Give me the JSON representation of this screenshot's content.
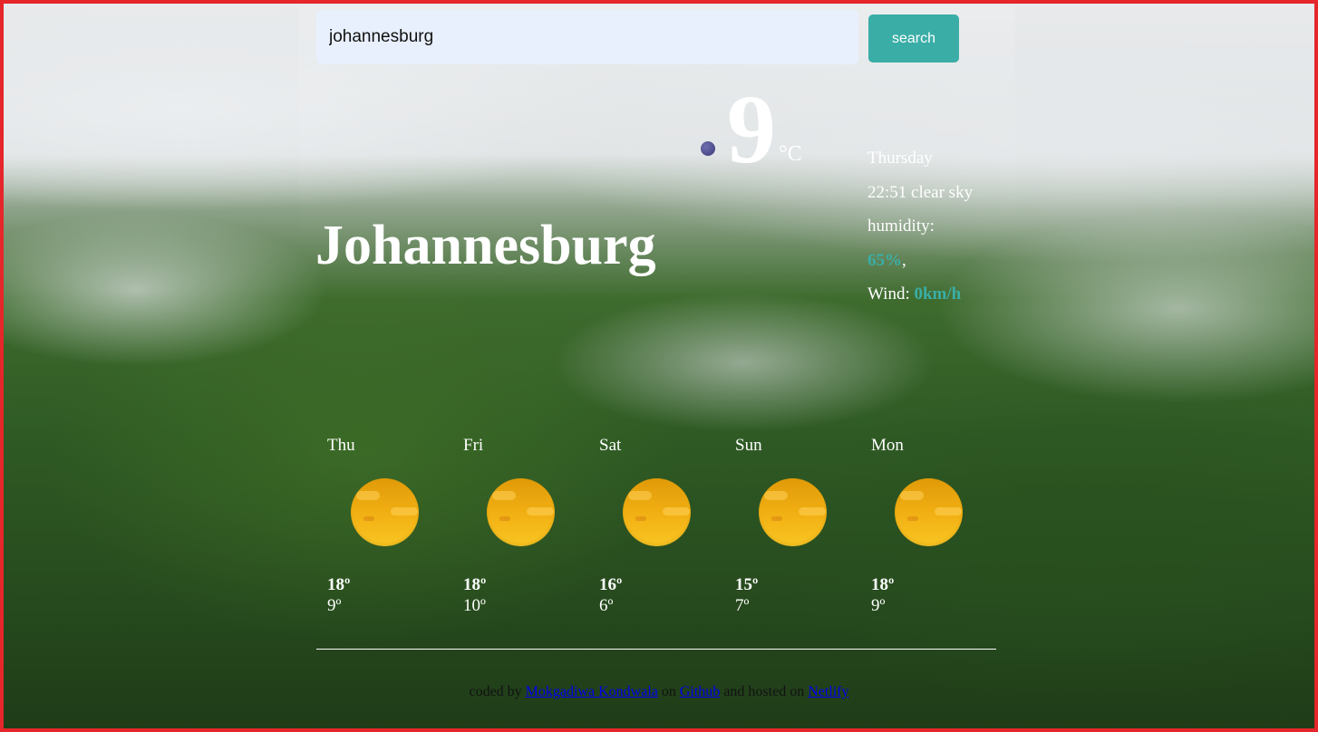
{
  "search": {
    "value": "johannesburg",
    "button_label": "search"
  },
  "current": {
    "city": "Johannesburg",
    "temperature": "9",
    "unit": "°C",
    "icon": "moon-icon",
    "day": "Thursday",
    "time_description": "22:51 clear sky",
    "humidity_label": "humidity:",
    "humidity_value": "65%",
    "wind_label": "Wind:",
    "wind_value": "0km/h"
  },
  "forecast": [
    {
      "day": "Thu",
      "high": "18º",
      "low": "9º",
      "icon": "sun-icon"
    },
    {
      "day": "Fri",
      "high": "18º",
      "low": "10º",
      "icon": "sun-icon"
    },
    {
      "day": "Sat",
      "high": "16º",
      "low": "6º",
      "icon": "sun-icon"
    },
    {
      "day": "Sun",
      "high": "15º",
      "low": "7º",
      "icon": "sun-icon"
    },
    {
      "day": "Mon",
      "high": "18º",
      "low": "9º",
      "icon": "sun-icon"
    }
  ],
  "footer": {
    "prefix": "coded by",
    "author": "Mokgadiwa Kondwala",
    "middle": "on",
    "repo_link": "Github",
    "middle2": "and hosted on",
    "host_link": "Netlify"
  },
  "colors": {
    "accent": "#3aaea6",
    "frame": "#e5262a",
    "input_bg": "#e9f0fd"
  }
}
